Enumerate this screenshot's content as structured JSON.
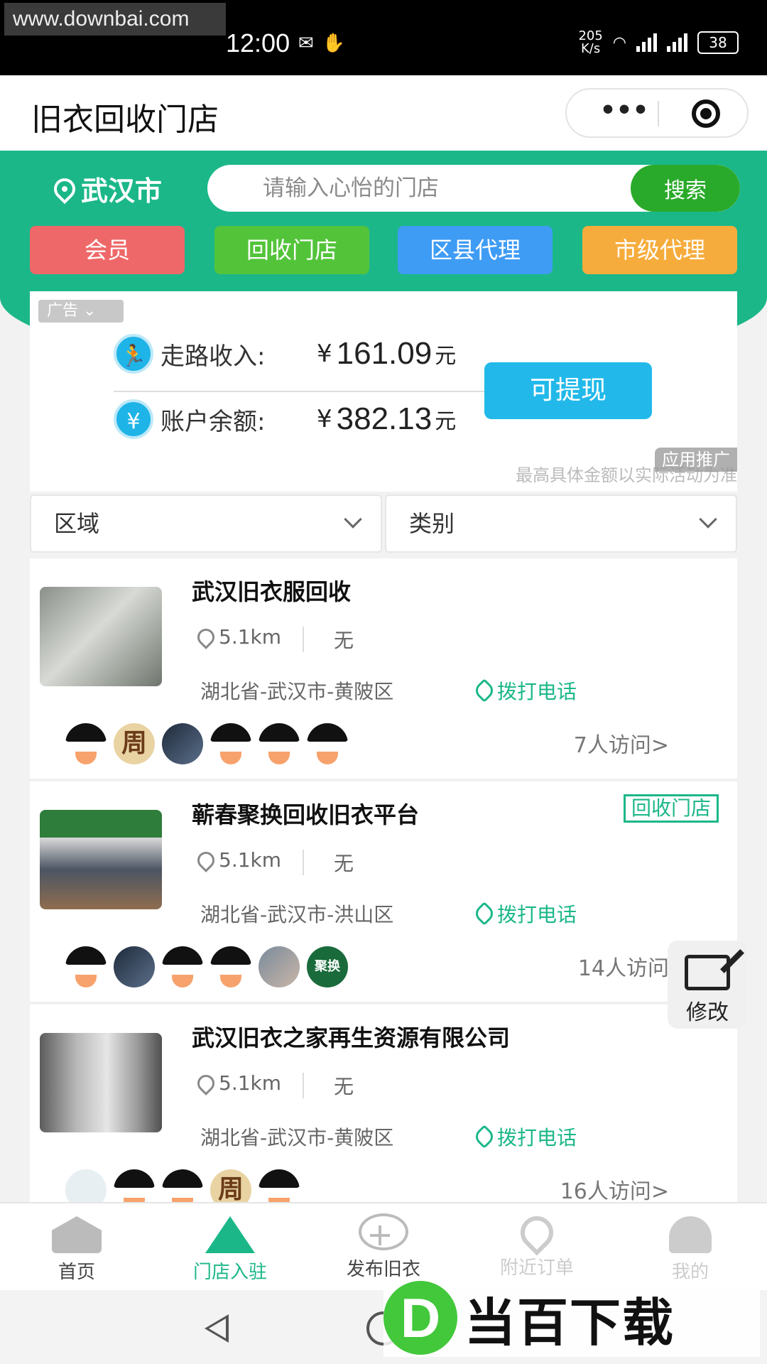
{
  "status_bar": {
    "watermark": "www.downbai.com",
    "time": "12:00",
    "net_speed_value": "205",
    "net_speed_unit": "K/s",
    "battery": "38"
  },
  "app": {
    "title": "旧衣回收门店",
    "capsule_more": "•••"
  },
  "header": {
    "city": "武汉市",
    "search_placeholder": "请输入心怡的门店",
    "search_button": "搜索",
    "categories": [
      {
        "label": "会员",
        "color": "#ef6869"
      },
      {
        "label": "回收门店",
        "color": "#53c43a"
      },
      {
        "label": "区县代理",
        "color": "#3f9cf5"
      },
      {
        "label": "市级代理",
        "color": "#f6ac3c"
      }
    ]
  },
  "ad": {
    "tag": "广告 ⌄",
    "walk_label": "走路收入:",
    "walk_currency": "¥",
    "walk_amount": "161.09",
    "walk_unit": "元",
    "balance_label": "账户余额:",
    "balance_currency": "¥",
    "balance_amount": "382.13",
    "balance_unit": "元",
    "withdraw_button": "可提现",
    "note": "最高具体金额以实际活动为准",
    "app_tag": "应用推广"
  },
  "filters": {
    "region": "区域",
    "category": "类别"
  },
  "stores": [
    {
      "name": "武汉旧衣服回收",
      "tag": "",
      "distance": "5.1km",
      "extra": "无",
      "address": "湖北省-武汉市-黄陂区",
      "call": "拨打电话",
      "visits": "7人访问>"
    },
    {
      "name": "蕲春聚换回收旧衣平台",
      "tag": "回收门店",
      "distance": "5.1km",
      "extra": "无",
      "address": "湖北省-武汉市-洪山区",
      "call": "拨打电话",
      "visits": "14人访问"
    },
    {
      "name": "武汉旧衣之家再生资源有限公司",
      "tag": "",
      "distance": "5.1km",
      "extra": "无",
      "address": "湖北省-武汉市-黄陂区",
      "call": "拨打电话",
      "visits": "16人访问>"
    }
  ],
  "avatar_text": {
    "zhou": "周",
    "brand": "聚换"
  },
  "edit_fab": "修改",
  "tabbar": [
    {
      "label": "首页",
      "icon": "home-icon"
    },
    {
      "label": "门店入驻",
      "icon": "store-icon"
    },
    {
      "label": "发布旧衣",
      "icon": "plus-circle-icon"
    },
    {
      "label": "附近订单",
      "icon": "location-icon"
    },
    {
      "label": "我的",
      "icon": "user-icon"
    }
  ],
  "site_logo": {
    "letter": "D",
    "text": "当百下载"
  },
  "colors": {
    "brand_green": "#1bb789",
    "search_button": "#2aaa2a",
    "withdraw_button": "#22b9ea"
  }
}
